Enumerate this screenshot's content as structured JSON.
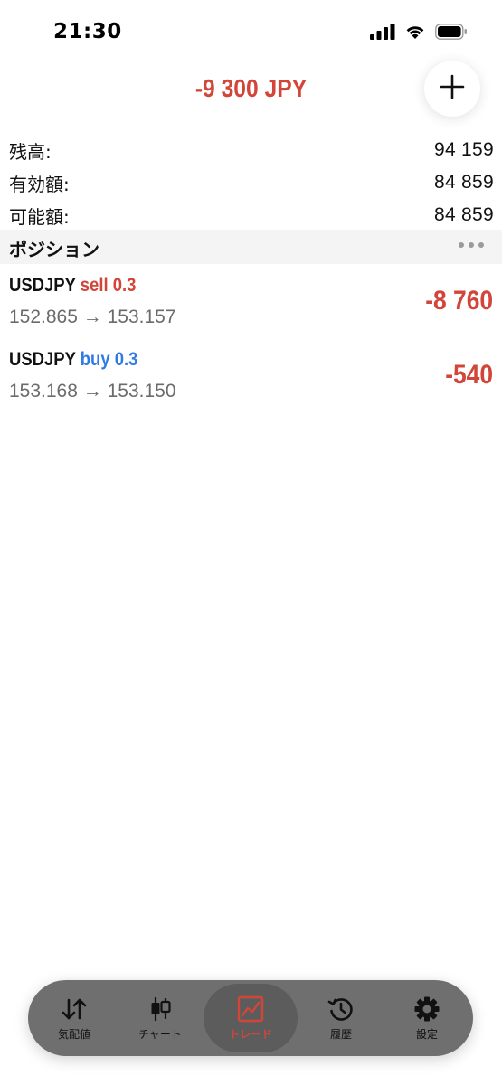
{
  "status_bar": {
    "time": "21:30"
  },
  "header": {
    "total_profit": "-9 300 JPY",
    "add_button_icon": "plus-icon"
  },
  "summary": [
    {
      "label": "残高:",
      "value": "94 159"
    },
    {
      "label": "有効額:",
      "value": "84 859"
    },
    {
      "label": "可能額:",
      "value": "84 859"
    }
  ],
  "positions_section": {
    "title": "ポジション",
    "more_icon": "more-horizontal-icon"
  },
  "positions": [
    {
      "symbol": "USDJPY",
      "side": "sell",
      "volume": "0.3",
      "open_price": "152.865",
      "arrow": "→",
      "current_price": "153.157",
      "profit": "-8 760"
    },
    {
      "symbol": "USDJPY",
      "side": "buy",
      "volume": "0.3",
      "open_price": "153.168",
      "arrow": "→",
      "current_price": "153.150",
      "profit": "-540"
    }
  ],
  "tab_bar": {
    "tabs": [
      {
        "label": "気配値",
        "icon": "quotes-arrows-icon",
        "active": false
      },
      {
        "label": "チャート",
        "icon": "candlestick-chart-icon",
        "active": false
      },
      {
        "label": "トレード",
        "icon": "trade-chart-icon",
        "active": true
      },
      {
        "label": "履歴",
        "icon": "history-clock-icon",
        "active": false
      },
      {
        "label": "設定",
        "icon": "gear-icon",
        "active": false
      }
    ]
  },
  "colors": {
    "loss_red": "#d2463a",
    "buy_blue": "#2f7ae5",
    "tab_bar_bg": "#6f6f6f",
    "section_bg": "#f4f4f5"
  }
}
